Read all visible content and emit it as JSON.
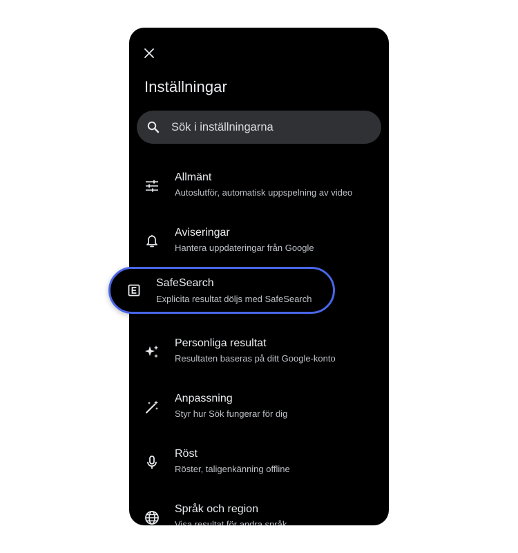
{
  "header": {
    "close_icon": "close-icon",
    "title": "Inställningar"
  },
  "search": {
    "icon": "search-icon",
    "placeholder": "Sök i inställningarna"
  },
  "menu": {
    "items": [
      {
        "icon": "tune-icon",
        "title": "Allmänt",
        "subtitle": "Autoslutför, automatisk uppspelning av video"
      },
      {
        "icon": "bell-icon",
        "title": "Aviseringar",
        "subtitle": "Hantera uppdateringar från Google"
      },
      {
        "icon": "explicit-icon",
        "title": "SafeSearch",
        "subtitle": "Explicita resultat döljs med SafeSearch",
        "highlighted": true
      },
      {
        "icon": "sparkle-icon",
        "title": "Personliga resultat",
        "subtitle": "Resultaten baseras på ditt Google-konto"
      },
      {
        "icon": "magic-wand-icon",
        "title": "Anpassning",
        "subtitle": "Styr hur Sök fungerar för dig"
      },
      {
        "icon": "microphone-icon",
        "title": "Röst",
        "subtitle": "Röster, taligenkänning offline"
      },
      {
        "icon": "globe-icon",
        "title": "Språk och region",
        "subtitle": "Visa resultat för andra språk"
      }
    ]
  },
  "colors": {
    "background": "#000000",
    "text_primary": "#e8eaed",
    "text_secondary": "#bdc1c6",
    "search_bg": "#303134",
    "highlight_border": "#4a66e8"
  }
}
